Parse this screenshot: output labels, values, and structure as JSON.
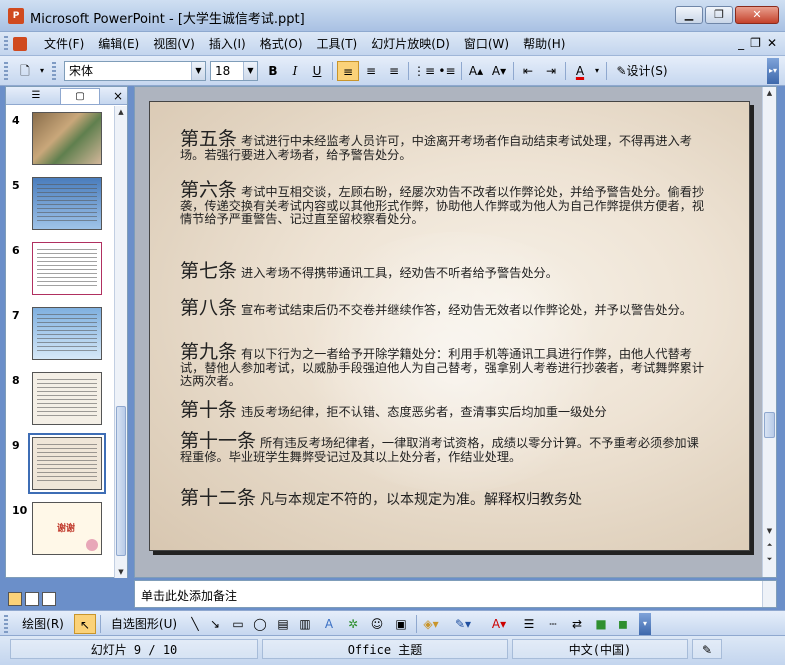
{
  "window": {
    "app_icon_text": "P",
    "title": "Microsoft PowerPoint - [大学生诚信考试.ppt]",
    "minimize": "▁",
    "restore": "❐",
    "close": "✕"
  },
  "menu": {
    "items": [
      "文件(F)",
      "编辑(E)",
      "视图(V)",
      "插入(I)",
      "格式(O)",
      "工具(T)",
      "幻灯片放映(D)",
      "窗口(W)",
      "帮助(H)"
    ],
    "right_min": "_",
    "right_restore": "❐",
    "right_close": "✕"
  },
  "toolbar": {
    "font": "宋体",
    "size": "18",
    "bold": "B",
    "italic": "I",
    "underline": "U",
    "shadow": "S",
    "design": "设计(S)",
    "font_color": "A"
  },
  "left_pane": {
    "close": "×",
    "thumbnails": [
      {
        "num": "4"
      },
      {
        "num": "5"
      },
      {
        "num": "6"
      },
      {
        "num": "7"
      },
      {
        "num": "8"
      },
      {
        "num": "9"
      },
      {
        "num": "10",
        "text": "谢谢"
      }
    ]
  },
  "slide": {
    "clauses": [
      {
        "head": "第五条",
        "text": "考试进行中未经监考人员许可，中途离开考场者作自动结束考试处理，不得再进入考场。若强行要进入考场者，给予警告处分。"
      },
      {
        "head": "第六条",
        "text": "考试中互相交谈，左顾右盼，经屡次劝告不改者以作弊论处，并给予警告处分。偷看抄袭，传递交换有关考试内容或以其他形式作弊，协助他人作弊或为他人为自己作弊提供方便者，视情节给予严重警告、记过直至留校察看处分。"
      },
      {
        "head": "第七条",
        "text": "进入考场不得携带通讯工具，经劝告不听者给予警告处分。"
      },
      {
        "head": "第八条",
        "text": "宣布考试结束后仍不交卷并继续作答，经劝告无效者以作弊论处，并予以警告处分。"
      },
      {
        "head": "第九条",
        "text": "有以下行为之一者给予开除学籍处分：利用手机等通讯工具进行作弊，由他人代替考试，替他人参加考试，以威胁手段强迫他人为自己替考，强拿别人考卷进行抄袭者，考试舞弊累计达两次者。"
      },
      {
        "head": "第十条",
        "text": "违反考场纪律，拒不认错、态度恶劣者，查清事实后均加重一级处分"
      },
      {
        "head": "第十一条",
        "text": "所有违反考场纪律者，一律取消考试资格，成绩以零分计算。不予重考必须参加课程重修。毕业班学生舞弊受记过及其以上处分者，作结业处理。"
      },
      {
        "head": "第十二条",
        "text": "凡与本规定不符的，以本规定为准。解释权归教务处"
      }
    ]
  },
  "notes": {
    "placeholder": "单击此处添加备注"
  },
  "draw_toolbar": {
    "draw": "绘图(R)",
    "autoshapes": "自选图形(U)"
  },
  "status": {
    "slide_index": "幻灯片 9 / 10",
    "theme": "Office 主题",
    "language": "中文(中国)"
  }
}
